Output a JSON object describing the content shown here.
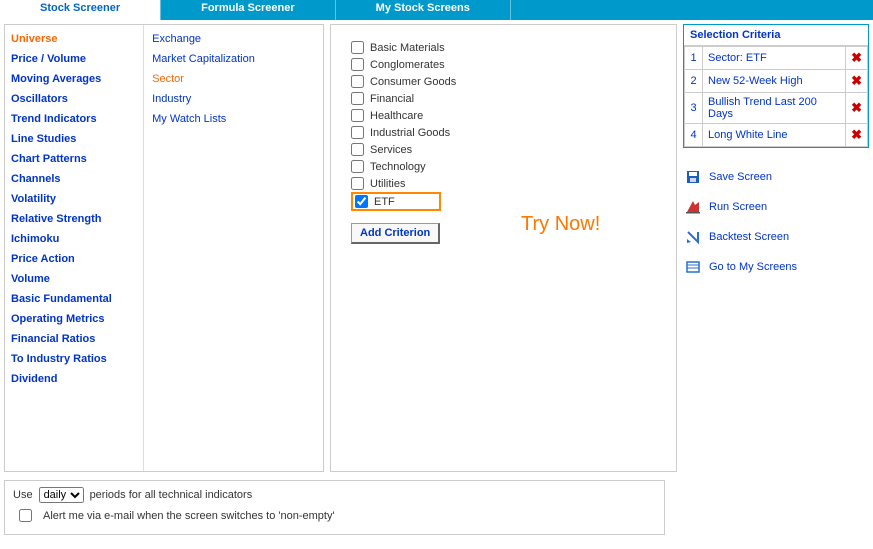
{
  "tabs": {
    "stock_screener": "Stock Screener",
    "formula_screener": "Formula Screener",
    "my_stock_screens": "My Stock Screens"
  },
  "categories": [
    "Universe",
    "Price / Volume",
    "Moving Averages",
    "Oscillators",
    "Trend Indicators",
    "Line Studies",
    "Chart Patterns",
    "Channels",
    "Volatility",
    "Relative Strength",
    "Ichimoku",
    "Price Action",
    "Volume",
    "Basic Fundamental",
    "Operating Metrics",
    "Financial Ratios",
    "To Industry Ratios",
    "Dividend"
  ],
  "active_category_index": 0,
  "sub_categories": [
    "Exchange",
    "Market Capitalization",
    "Sector",
    "Industry",
    "My Watch Lists"
  ],
  "active_sub_index": 2,
  "sectors": [
    {
      "label": "Basic Materials",
      "checked": false
    },
    {
      "label": "Conglomerates",
      "checked": false
    },
    {
      "label": "Consumer Goods",
      "checked": false
    },
    {
      "label": "Financial",
      "checked": false
    },
    {
      "label": "Healthcare",
      "checked": false
    },
    {
      "label": "Industrial Goods",
      "checked": false
    },
    {
      "label": "Services",
      "checked": false
    },
    {
      "label": "Technology",
      "checked": false
    },
    {
      "label": "Utilities",
      "checked": false
    },
    {
      "label": "ETF",
      "checked": true,
      "highlight": true
    }
  ],
  "add_criterion_label": "Add Criterion",
  "try_now_label": "Try Now!",
  "selection_criteria": {
    "header": "Selection Criteria",
    "items": [
      "Sector: ETF",
      "New 52-Week High",
      "Bullish Trend Last 200 Days",
      "Long White Line"
    ]
  },
  "actions": {
    "save_screen": "Save Screen",
    "run_screen": "Run Screen",
    "backtest_screen": "Backtest Screen",
    "go_to_my_screens": "Go to My Screens"
  },
  "bottom": {
    "use_label": "Use",
    "period_value": "daily",
    "periods_suffix": "periods for all technical indicators",
    "alert_label": "Alert me via e-mail when the screen switches to 'non-empty'"
  }
}
